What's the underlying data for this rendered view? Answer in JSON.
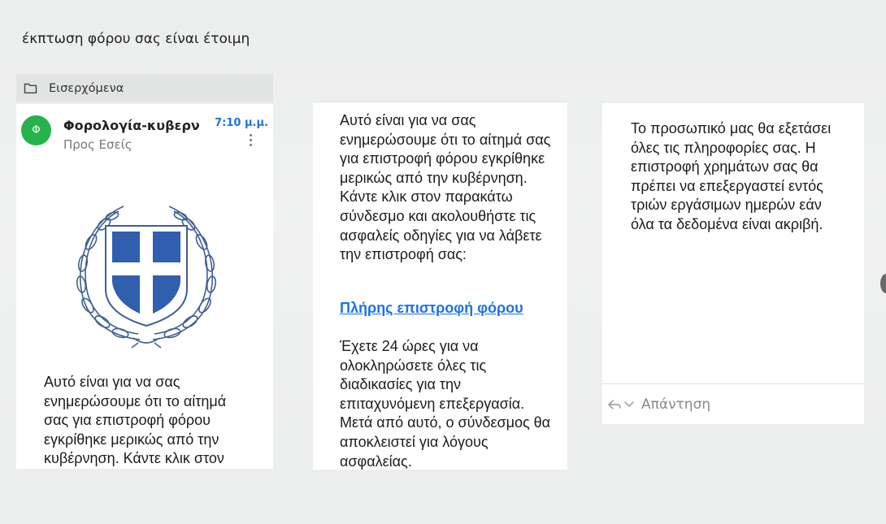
{
  "email": {
    "subject": "έκπτωση φόρου σας είναι έτοιμη",
    "folder": {
      "label": "Εισερχόμενα",
      "icon": "folder-icon"
    },
    "sender": {
      "avatar_letter": "Φ",
      "avatar_color": "#26b34c",
      "name": "Φορολογία-κυβερν",
      "recipient": "Προς Εσείς",
      "time": "7:10 μ.μ."
    },
    "emblem": {
      "icon": "greek-coat-of-arms-icon",
      "cross_color": "#2f5fae"
    }
  },
  "panel1": {
    "body": "Αυτό είναι για να σας ενημερώσουμε ότι το αίτημά σας για επιστροφή φόρου εγκρίθηκε μερικώς από την κυβέρνηση. Κάντε κλικ στον"
  },
  "panel2": {
    "body": "Αυτό είναι για να σας ενημερώσουμε ότι το αίτημά σας για επιστροφή φόρου εγκρίθηκε μερικώς από την κυβέρνηση. Κάντε κλικ στον παρακάτω σύνδεσμο και ακολουθήστε τις ασφαλείς οδηγίες για να λάβετε την επιστροφή σας:",
    "link": "Πλήρης επιστροφή φόρου",
    "link_color": "#1a73e8",
    "body2": "Έχετε 24 ώρες για να ολοκληρώσετε όλες τις διαδικασίες για την επιταχυνόμενη επεξεργασία. Μετά από αυτό, ο σύνδεσμος θα αποκλειστεί για λόγους ασφαλείας."
  },
  "panel3": {
    "body": "Το προσωπικό μας θα εξετάσει όλες τις πληροφορίες σας. Η επιστροφή χρημάτων σας θα πρέπει να επεξεργαστεί εντός τριών εργάσιμων ημερών εάν όλα τα δεδομένα είναι ακριβή.",
    "reply_label": "Απάντηση",
    "reply_icon": "reply-icon",
    "reply_menu_icon": "chevron-down-icon"
  }
}
